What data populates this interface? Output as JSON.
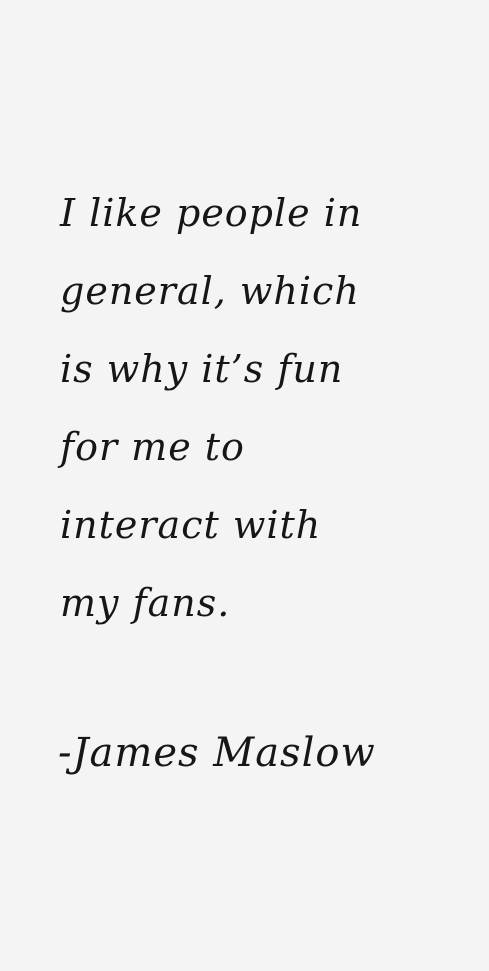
{
  "quote": {
    "lines": [
      "I like people in",
      "general, which",
      "is why it’s fun",
      "for me to",
      "interact with",
      "my fans."
    ],
    "attribution": "-James Maslow"
  }
}
